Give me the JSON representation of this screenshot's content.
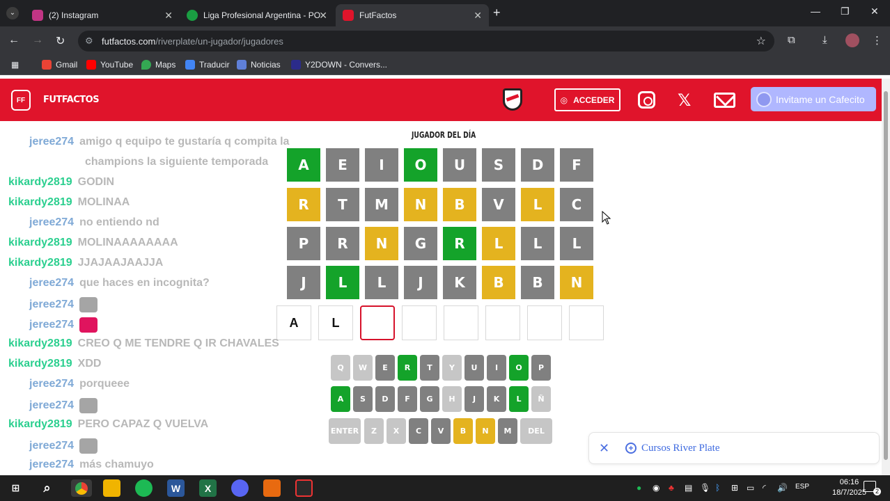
{
  "browser": {
    "tabs": [
      {
        "title": "(2) Instagram",
        "icon": "instagram-icon",
        "color": "#c13584"
      },
      {
        "title": "Liga Profesional Argentina - PO",
        "icon": "soccer-ball-icon",
        "color": "#1a9d42"
      },
      {
        "title": "FutFactos",
        "icon": "futfactos-icon",
        "color": "#e0142b"
      }
    ],
    "url_host": "futfactos.com",
    "url_path": "/riverplate/un-jugador/jugadores",
    "bookmarks": [
      "Gmail",
      "YouTube",
      "Maps",
      "Traducir",
      "Noticias",
      "Y2DOWN - Convers..."
    ]
  },
  "site": {
    "logo_text": "FUTFACTOS",
    "acceder_label": "ACCEDER",
    "cafecito_label": "Invitame un Cafecito"
  },
  "game": {
    "title": "JUGADOR DEL DÍA",
    "colors": {
      "green": "#14a32a",
      "gray": "#808080",
      "yellow": "#e4b31f",
      "lightgray": "#c6c6c6",
      "red_border": "#d6122b"
    },
    "rows": [
      [
        {
          "l": "A",
          "s": "green"
        },
        {
          "l": "E",
          "s": "gray"
        },
        {
          "l": "I",
          "s": "gray"
        },
        {
          "l": "O",
          "s": "green"
        },
        {
          "l": "U",
          "s": "gray"
        },
        {
          "l": "S",
          "s": "gray"
        },
        {
          "l": "D",
          "s": "gray"
        },
        {
          "l": "F",
          "s": "gray"
        }
      ],
      [
        {
          "l": "R",
          "s": "yellow"
        },
        {
          "l": "T",
          "s": "gray"
        },
        {
          "l": "M",
          "s": "gray"
        },
        {
          "l": "N",
          "s": "yellow"
        },
        {
          "l": "B",
          "s": "yellow"
        },
        {
          "l": "V",
          "s": "gray"
        },
        {
          "l": "L",
          "s": "yellow"
        },
        {
          "l": "C",
          "s": "gray"
        }
      ],
      [
        {
          "l": "P",
          "s": "gray"
        },
        {
          "l": "R",
          "s": "gray"
        },
        {
          "l": "N",
          "s": "yellow"
        },
        {
          "l": "G",
          "s": "gray"
        },
        {
          "l": "R",
          "s": "green"
        },
        {
          "l": "L",
          "s": "yellow"
        },
        {
          "l": "L",
          "s": "gray"
        },
        {
          "l": "L",
          "s": "gray"
        }
      ],
      [
        {
          "l": "J",
          "s": "gray"
        },
        {
          "l": "L",
          "s": "green"
        },
        {
          "l": "L",
          "s": "gray"
        },
        {
          "l": "J",
          "s": "gray"
        },
        {
          "l": "K",
          "s": "gray"
        },
        {
          "l": "B",
          "s": "yellow"
        },
        {
          "l": "B",
          "s": "gray"
        },
        {
          "l": "N",
          "s": "yellow"
        }
      ]
    ],
    "current_input": [
      "A",
      "L",
      "",
      "",
      "",
      "",
      "",
      ""
    ],
    "current_index": 2,
    "keyboard": [
      [
        {
          "k": "Q",
          "s": "lightgray"
        },
        {
          "k": "W",
          "s": "lightgray"
        },
        {
          "k": "E",
          "s": "gray"
        },
        {
          "k": "R",
          "s": "green"
        },
        {
          "k": "T",
          "s": "gray"
        },
        {
          "k": "Y",
          "s": "lightgray"
        },
        {
          "k": "U",
          "s": "gray"
        },
        {
          "k": "I",
          "s": "gray"
        },
        {
          "k": "O",
          "s": "green"
        },
        {
          "k": "P",
          "s": "gray"
        }
      ],
      [
        {
          "k": "A",
          "s": "green"
        },
        {
          "k": "S",
          "s": "gray"
        },
        {
          "k": "D",
          "s": "gray"
        },
        {
          "k": "F",
          "s": "gray"
        },
        {
          "k": "G",
          "s": "gray"
        },
        {
          "k": "H",
          "s": "lightgray"
        },
        {
          "k": "J",
          "s": "gray"
        },
        {
          "k": "K",
          "s": "gray"
        },
        {
          "k": "L",
          "s": "green"
        },
        {
          "k": "Ñ",
          "s": "lightgray"
        }
      ],
      [
        {
          "k": "ENTER",
          "s": "lightgray"
        },
        {
          "k": "Z",
          "s": "lightgray"
        },
        {
          "k": "X",
          "s": "lightgray"
        },
        {
          "k": "C",
          "s": "gray"
        },
        {
          "k": "V",
          "s": "gray"
        },
        {
          "k": "B",
          "s": "yellow"
        },
        {
          "k": "N",
          "s": "yellow"
        },
        {
          "k": "M",
          "s": "gray"
        },
        {
          "k": "DEL",
          "s": "lightgray"
        }
      ]
    ]
  },
  "chat": [
    {
      "user": "jeree274",
      "msg": "amigo q equipo te gustaría q compita la",
      "type": "jeree"
    },
    {
      "user": "",
      "msg": "champions la siguiente temporada",
      "type": "cont"
    },
    {
      "user": "kikardy2819",
      "msg": "GODIN",
      "type": "kika"
    },
    {
      "user": "kikardy2819",
      "msg": "MOLINAA",
      "type": "kika"
    },
    {
      "user": "jeree274",
      "msg": "no entiendo nd",
      "type": "jeree"
    },
    {
      "user": "kikardy2819",
      "msg": "MOLINAAAAAAAA",
      "type": "kika"
    },
    {
      "user": "kikardy2819",
      "msg": "JJAJAAJAAJJA",
      "type": "kika"
    },
    {
      "user": "jeree274",
      "msg": "que haces en incognita?",
      "type": "jeree"
    },
    {
      "user": "jeree274",
      "msg": "",
      "emote": "cat-emote",
      "type": "jeree"
    },
    {
      "user": "jeree274",
      "msg": "",
      "emote": "heart-emote",
      "type": "jeree"
    },
    {
      "user": "kikardy2819",
      "msg": "CREO Q ME TENDRE Q IR CHAVALES",
      "type": "kika"
    },
    {
      "user": "kikardy2819",
      "msg": "XDD",
      "type": "kika"
    },
    {
      "user": "jeree274",
      "msg": "porqueee",
      "type": "jeree"
    },
    {
      "user": "jeree274",
      "msg": "",
      "emote": "cat-emote",
      "type": "jeree"
    },
    {
      "user": "kikardy2819",
      "msg": "PERO CAPAZ Q VUELVA",
      "type": "kika"
    },
    {
      "user": "jeree274",
      "msg": "",
      "emote": "cat-emote",
      "type": "jeree"
    },
    {
      "user": "jeree274",
      "msg": "más chamuyo",
      "type": "jeree"
    }
  ],
  "chat_colors": {
    "jeree": "#7fa9d6",
    "kika": "#2bcf8f"
  },
  "toast": {
    "text": "Cursos River Plate"
  },
  "taskbar": {
    "lang": "ESP",
    "time": "06:16",
    "date": "18/7/2025",
    "notif_count": "2"
  }
}
